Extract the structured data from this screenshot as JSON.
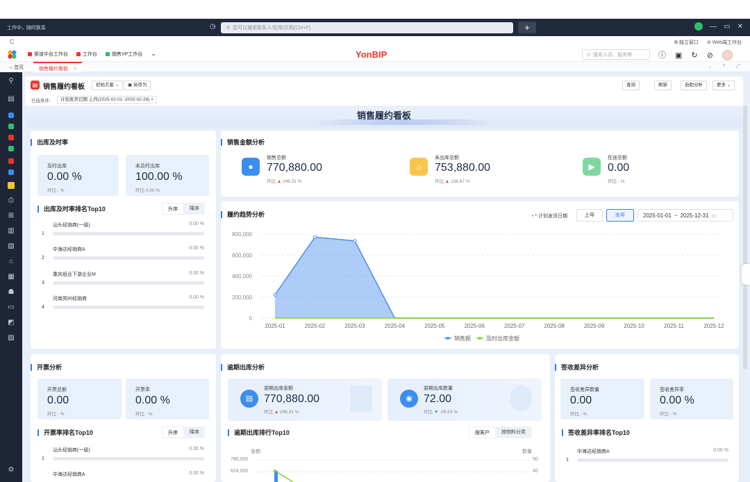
{
  "titlebar": {
    "status": "工作中，随时联系",
    "search_placeholder": "您可以搜索联系人/应用/文档(Ctrl+F)",
    "plus": "+",
    "window_controls": [
      "—",
      "▭",
      "✕"
    ]
  },
  "row2": {
    "open_window": "独立窗口",
    "web_workbench": "Web端工作台"
  },
  "appbar": {
    "brand": "YonBIP",
    "tabs": [
      {
        "label": "渠道中台工作台",
        "color": "#e8372c"
      },
      {
        "label": "工作台",
        "color": "#e8372c"
      },
      {
        "label": "销售VP工作台",
        "color": "#2ec06e"
      }
    ],
    "user_search_placeholder": "搜索人员、服务等"
  },
  "page_tabs": {
    "home": "首页",
    "current": "销售履约看板"
  },
  "header": {
    "title": "销售履约看板",
    "scheme": "初始方案",
    "save_as": "另存为",
    "buttons": [
      "查询",
      "刷新",
      "自助分析",
      "更多"
    ]
  },
  "filter": {
    "label": "已选条件:",
    "tag": "计划发货日期 上月(2025-02-01~2025-02-28)"
  },
  "banner": {
    "title": "销售履约看板"
  },
  "outbound": {
    "title": "出库及时率",
    "timely": {
      "label": "及时出库",
      "value": "0.00 %",
      "compare": "环比 - %"
    },
    "untimely": {
      "label": "未及时出库",
      "value": "100.00 %",
      "compare": "环比 0.00 %"
    }
  },
  "outbound_rank": {
    "title": "出库及时率排名Top10",
    "asc": "升序",
    "desc": "降序",
    "rows": [
      {
        "n": "1",
        "name": "汕头经销商(一级)",
        "pct": "0.00 %"
      },
      {
        "n": "2",
        "name": "中海达经销商A",
        "pct": "0.00 %"
      },
      {
        "n": "3",
        "name": "重庆纸业下游企业M",
        "pct": "0.00 %"
      },
      {
        "n": "4",
        "name": "河南郑州经销商",
        "pct": "0.00 %"
      }
    ]
  },
  "sales_amount": {
    "title": "销售金额分析",
    "items": [
      {
        "label": "销售总额",
        "value": "770,880.00",
        "cmp": "环比",
        "arrow": "▲",
        "pct": "246.31 %",
        "icon": "user-icon",
        "color": "#3b8df0"
      },
      {
        "label": "未出库总额",
        "value": "753,880.00",
        "cmp": "环比",
        "arrow": "▲",
        "pct": "238.67 %",
        "icon": "house-icon",
        "color": "#f5a623"
      },
      {
        "label": "在途总额",
        "value": "0.00",
        "cmp": "环比",
        "arrow": "",
        "pct": "- %",
        "icon": "truck-icon",
        "color": "#2ec06e"
      }
    ]
  },
  "trend": {
    "title": "履约趋势分析",
    "date_label": "* 计划发货日期",
    "last_year": "上年",
    "this_year": "本年",
    "range_start": "2025-01-01",
    "range_sep": "~",
    "range_end": "2025-12-31",
    "legend": [
      "销售额",
      "及时出库金额"
    ]
  },
  "chart_data": {
    "type": "area",
    "x": [
      "2025-01",
      "2025-02",
      "2025-03",
      "2025-04",
      "2025-05",
      "2025-06",
      "2025-07",
      "2025-08",
      "2025-09",
      "2025-10",
      "2025-11",
      "2025-12"
    ],
    "series": [
      {
        "name": "销售额",
        "values": [
          222000,
          770880,
          735000,
          0,
          0,
          0,
          0,
          0,
          0,
          0,
          0,
          0
        ],
        "color": "#4a8ef0"
      },
      {
        "name": "及时出库金额",
        "values": [
          0,
          0,
          0,
          0,
          0,
          0,
          0,
          0,
          0,
          0,
          0,
          0
        ],
        "color": "#7ed321"
      }
    ],
    "yticks": [
      "0",
      "200,000",
      "400,000",
      "600,000",
      "800,000"
    ],
    "ylim": [
      0,
      800000
    ],
    "grid": true,
    "legend": "bottom"
  },
  "invoice": {
    "title": "开票分析",
    "total": {
      "label": "开票总额",
      "value": "0.00",
      "compare": "环比 - %"
    },
    "rate": {
      "label": "开票率",
      "value": "0.00 %",
      "compare": "环比 - %"
    }
  },
  "invoice_rank": {
    "title": "开票率排名Top10",
    "asc": "升序",
    "desc": "降序",
    "rows": [
      {
        "n": "1",
        "name": "汕头经销商(一级)",
        "pct": "0.00 %"
      },
      {
        "n": "2",
        "name": "中海达经销商A",
        "pct": "0.00 %"
      }
    ]
  },
  "overdue": {
    "title": "逾期出库分析",
    "amount": {
      "label": "逾期出库金额",
      "value": "770,880.00",
      "cmp": "环比",
      "arrow": "▲",
      "pct": "246.31 %"
    },
    "count": {
      "label": "逾期出库数量",
      "value": "72.00",
      "cmp": "环比",
      "arrow": "▼",
      "pct": "-56.63 %"
    }
  },
  "overdue_rank": {
    "title": "逾期出库排行Top10",
    "by_customer": "按客户",
    "by_material": "按物料分类",
    "left_axis": "金额",
    "right_axis": "数量",
    "left_ticks": [
      "780,000",
      "624,000"
    ],
    "right_ticks": [
      "50",
      "40"
    ]
  },
  "receipt": {
    "title": "签收差异分析",
    "qty": {
      "label": "签收差异数量",
      "value": "0.00",
      "compare": "环比 - %"
    },
    "rate": {
      "label": "签收差异率",
      "value": "0.00 %",
      "compare": "环比 - %"
    }
  },
  "receipt_rank": {
    "title": "签收差异率排名Top10",
    "rows": [
      {
        "n": "1",
        "name": "中海达经销商A",
        "pct": "0.00 %"
      }
    ]
  }
}
